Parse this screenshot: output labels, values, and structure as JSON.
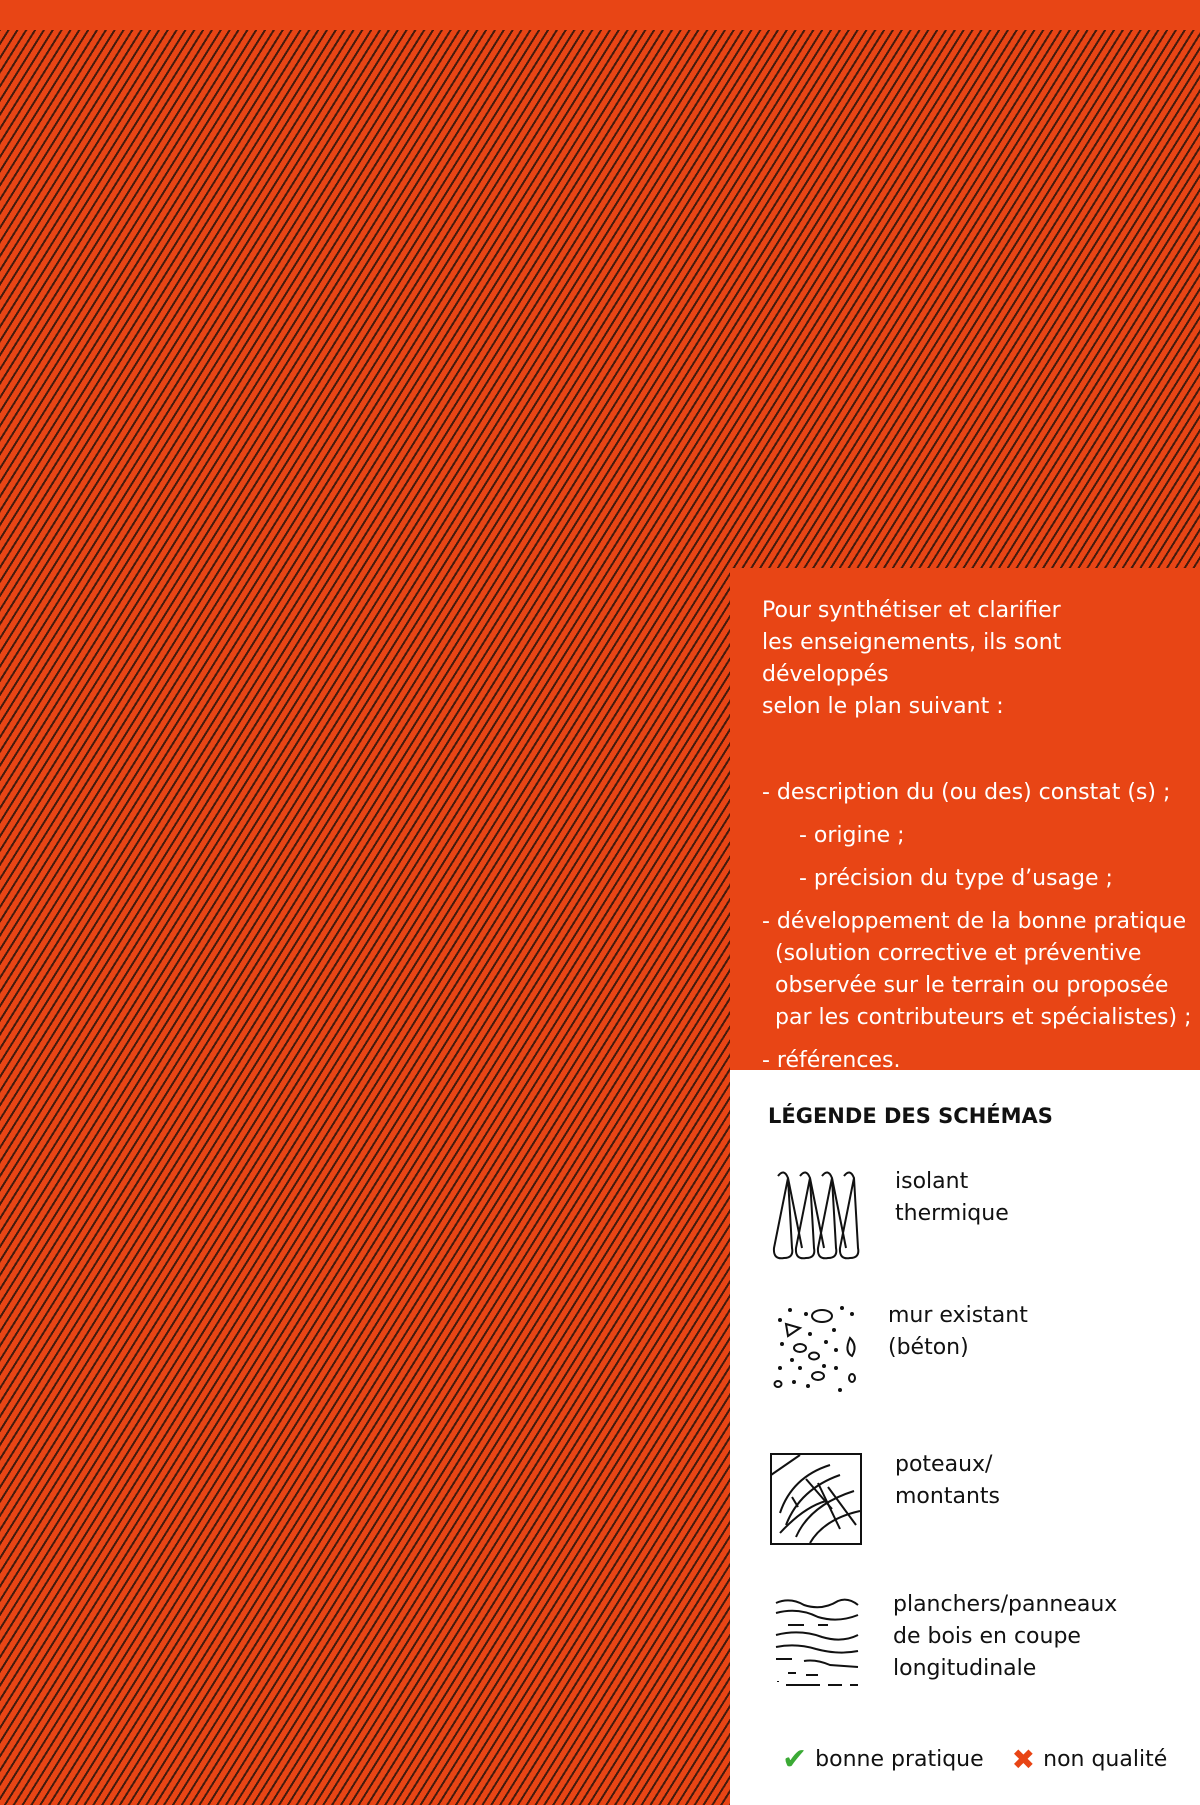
{
  "colors": {
    "accent": "#E84515",
    "good": "#3BAA35",
    "text_light": "#ffffff"
  },
  "intro": {
    "line1": "Pour synthétiser et clarifier",
    "line2": "les enseignements, ils sont développés",
    "line3": "selon le plan suivant :"
  },
  "plan": [
    "- description du (ou des) constat (s) ;",
    "- origine ;",
    "- précision du type d’usage ;",
    "- développement de la bonne pratique (solution corrective et préventive observée sur le terrain ou proposée par les contributeurs et spécialistes) ;",
    "- références."
  ],
  "legend": {
    "title": "LÉGENDE DES SCHÉMAS",
    "items": [
      {
        "icon": "insulation-icon",
        "label_line1": "isolant",
        "label_line2": "thermique"
      },
      {
        "icon": "concrete-wall-icon",
        "label_line1": "mur existant",
        "label_line2": "(béton)"
      },
      {
        "icon": "wood-post-icon",
        "label_line1": "poteaux/",
        "label_line2": "montants"
      },
      {
        "icon": "wood-plank-icon",
        "label_line1": "planchers/panneaux",
        "label_line2": "de bois en coupe",
        "label_line3": "longitudinale"
      }
    ],
    "good_label": "bonne pratique",
    "bad_label": "non qualité",
    "good_icon": "checkmark-icon",
    "bad_icon": "cross-icon"
  }
}
